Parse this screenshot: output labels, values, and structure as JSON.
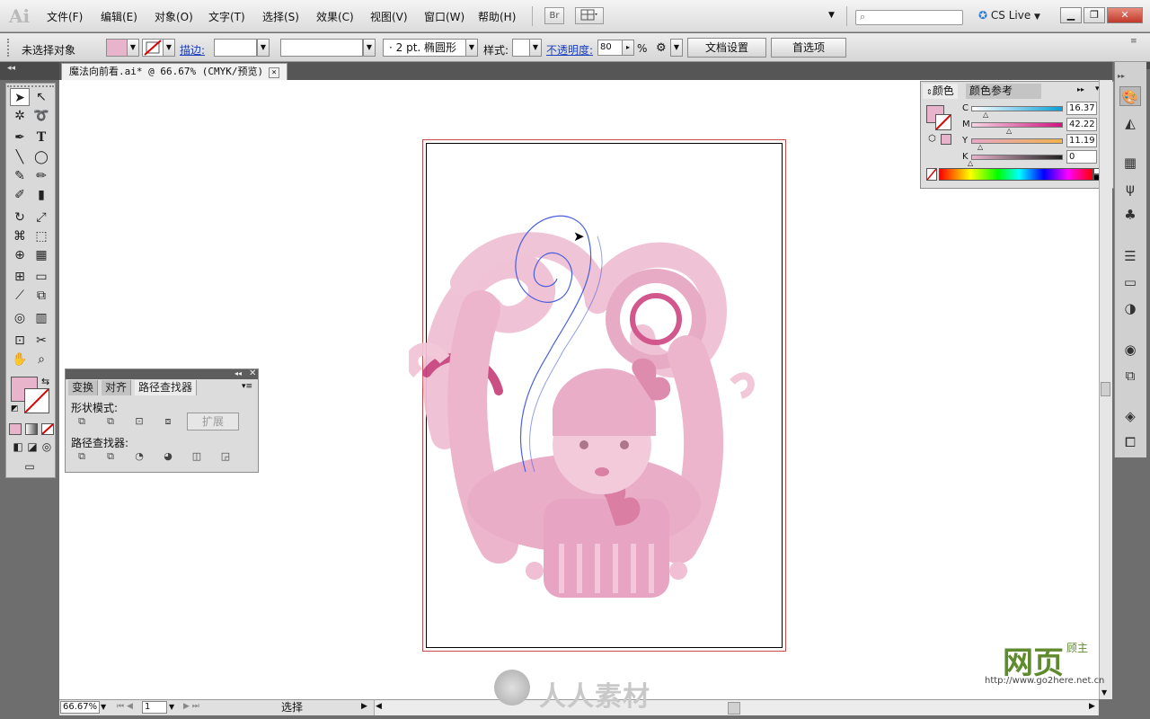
{
  "app": {
    "logo": "Ai"
  },
  "menu": [
    "文件(F)",
    "编辑(E)",
    "对象(O)",
    "文字(T)",
    "选择(S)",
    "效果(C)",
    "视图(V)",
    "窗口(W)",
    "帮助(H)"
  ],
  "menubar_right": {
    "br_label": "Br",
    "cslive": "CS Live"
  },
  "control": {
    "selection_status": "未选择对象",
    "stroke_link": "描边:",
    "brush_size": "2 pt. 椭圆形",
    "style_label": "样式:",
    "opacity_link": "不透明度:",
    "opacity_value": "80",
    "opacity_unit": "%",
    "doc_setup": "文档设置",
    "preferences": "首选项"
  },
  "document_tab": "魔法向前看.ai* @ 66.67% (CMYK/预览)",
  "document_tab_close": "×",
  "pathfinder_panel": {
    "tabs": [
      "变换",
      "对齐",
      "路径查找器"
    ],
    "shape_modes_label": "形状模式:",
    "expand_button": "扩展",
    "pathfinders_label": "路径查找器:"
  },
  "color_panel": {
    "tabs": [
      "颜色",
      "颜色参考"
    ],
    "channels": [
      {
        "name": "C",
        "value": "16.37"
      },
      {
        "name": "M",
        "value": "42.22"
      },
      {
        "name": "Y",
        "value": "11.19"
      },
      {
        "name": "K",
        "value": "0"
      }
    ],
    "unit": "%",
    "fill_color": "#e8b4cc"
  },
  "statusbar": {
    "zoom": "66.67%",
    "artboard_number": "1",
    "tool_status": "选择"
  },
  "watermarks": {
    "center": "人人素材",
    "brand": "网页",
    "brand_small": "顾主",
    "url": "http://www.go2here.net.cn"
  },
  "colors": {
    "accent_pink": "#e8b4cc",
    "artboard_border": "#c84b4b"
  }
}
